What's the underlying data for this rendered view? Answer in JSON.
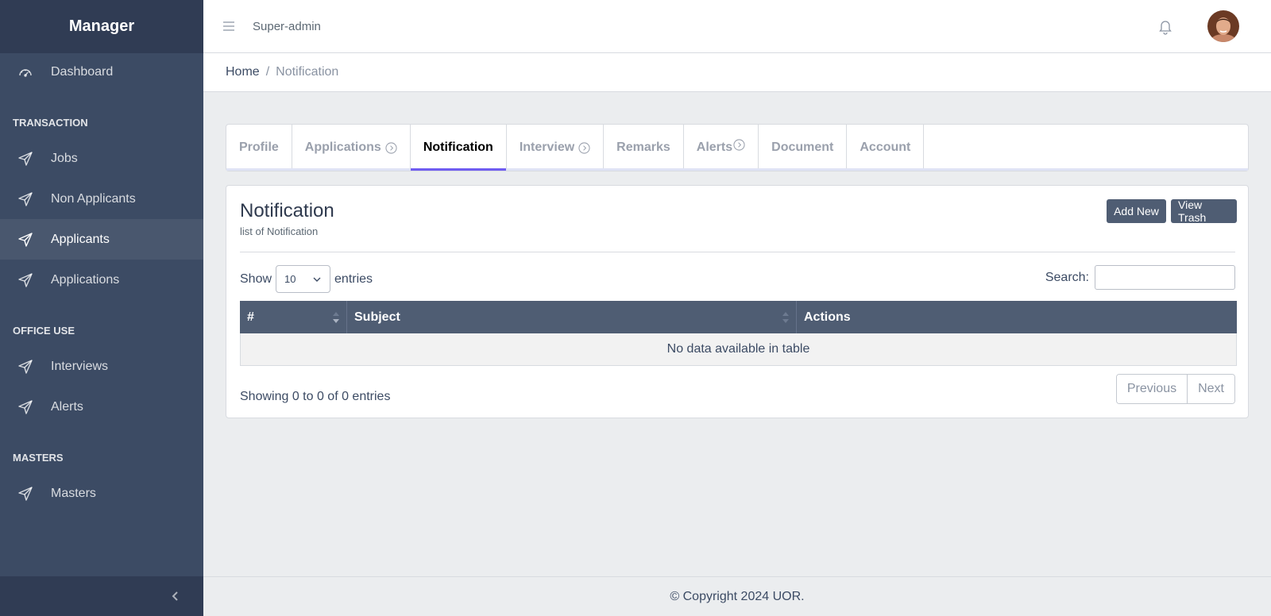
{
  "brand": "Manager",
  "sidebar": {
    "dashboard": "Dashboard",
    "sections": [
      {
        "title": "TRANSACTION",
        "items": [
          "Jobs",
          "Non Applicants",
          "Applicants",
          "Applications"
        ]
      },
      {
        "title": "OFFICE USE",
        "items": [
          "Interviews",
          "Alerts"
        ]
      },
      {
        "title": "MASTERS",
        "items": [
          "Masters"
        ]
      }
    ],
    "active_item": "Applicants"
  },
  "header": {
    "user_label": "Super-admin"
  },
  "breadcrumb": {
    "home": "Home",
    "separator": "/",
    "current": "Notification"
  },
  "tabs": [
    {
      "label": "Profile",
      "badge": false
    },
    {
      "label": "Applications",
      "badge": true
    },
    {
      "label": "Notification",
      "badge": false,
      "active": true
    },
    {
      "label": "Interview",
      "badge": true
    },
    {
      "label": "Remarks",
      "badge": false
    },
    {
      "label": "Alerts",
      "badge": true
    },
    {
      "label": "Document",
      "badge": false
    },
    {
      "label": "Account",
      "badge": false
    }
  ],
  "card": {
    "title": "Notification",
    "subtitle": "list of Notification",
    "add_new": "Add New",
    "view_trash": "View Trash"
  },
  "table_controls": {
    "show_label": "Show",
    "entries_value": "10",
    "entries_label": "entries",
    "search_label": "Search:",
    "search_value": ""
  },
  "table": {
    "columns": [
      "#",
      "Subject",
      "Actions"
    ],
    "empty_text": "No data available in table"
  },
  "pagination": {
    "info": "Showing 0 to 0 of 0 entries",
    "previous": "Previous",
    "next": "Next"
  },
  "footer": {
    "copyright": "© Copyright 2024 UOR."
  },
  "colors": {
    "sidebar_bg": "#3c4b64",
    "brand_bg": "#303c54",
    "table_header_bg": "#4f5d73",
    "active_tab_underline": "#6f5cf0",
    "button_bg": "#4f5d73"
  }
}
